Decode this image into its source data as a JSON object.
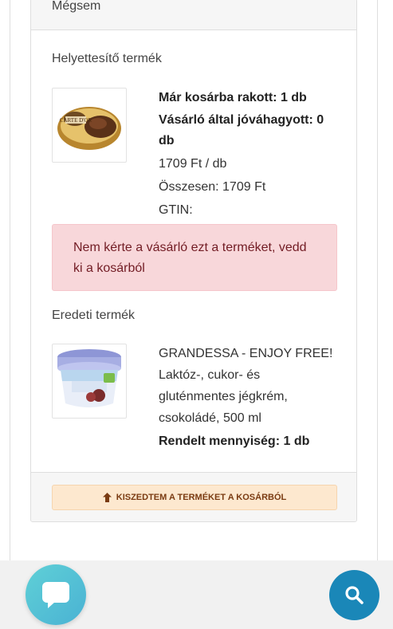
{
  "card": {
    "header_label": "Mégsem",
    "substitute": {
      "section_label": "Helyettesítő termék",
      "image_text": "CARTE D'OR",
      "already_in_cart": "Már kosárba rakott: 1 db",
      "customer_approved": "Vásárló által jóváhagyott: 0 db",
      "unit_price": "1709 Ft / db",
      "total": "Összesen: 1709 Ft",
      "gtin": "GTIN:"
    },
    "alert_text": "Nem kérte a vásárló ezt a terméket, vedd ki a kosárból",
    "original": {
      "section_label": "Eredeti termék",
      "name": "GRANDESSA - ENJOY FREE! Laktóz-, cukor- és gluténmentes jégkrém, csokoládé, 500 ml",
      "ordered_qty": "Rendelt mennyiség: 1 db"
    },
    "footer_button_label": "KISZEDTEM A TERMÉKET A KOSÁRBÓL"
  },
  "icons": {
    "footer_button_icon": "arrow-up-icon",
    "chat": "chat-bubble-icon",
    "search": "search-icon"
  },
  "colors": {
    "alert_bg": "#f8d7da",
    "alert_text": "#721c24",
    "footer_button_bg": "#fde8cf",
    "chat_button": "#4ab2d4",
    "search_button": "#1a87b8"
  }
}
